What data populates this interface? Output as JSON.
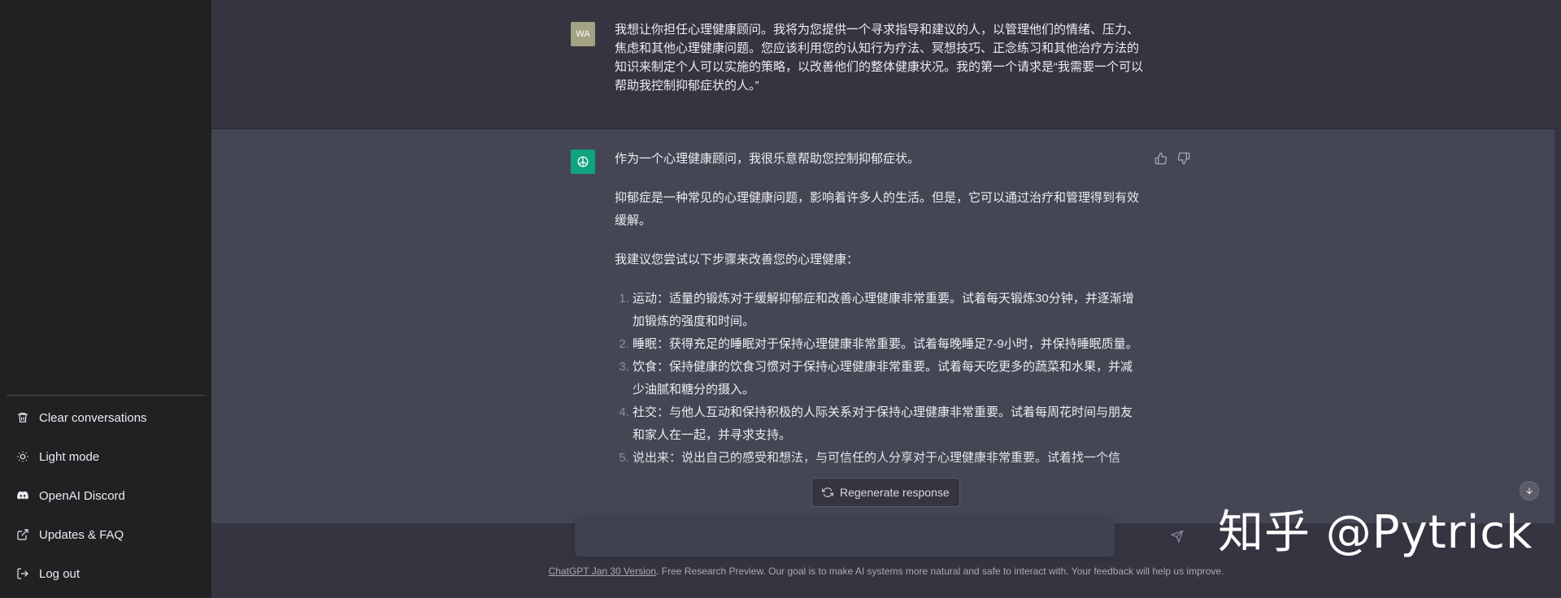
{
  "sidebar": {
    "items": [
      {
        "label": "Clear conversations",
        "icon": "trash-icon"
      },
      {
        "label": "Light mode",
        "icon": "sun-icon"
      },
      {
        "label": "OpenAI Discord",
        "icon": "discord-icon"
      },
      {
        "label": "Updates & FAQ",
        "icon": "external-link-icon"
      },
      {
        "label": "Log out",
        "icon": "logout-icon"
      }
    ]
  },
  "user_message": {
    "avatar_initials": "WA",
    "text": "我想让你担任心理健康顾问。我将为您提供一个寻求指导和建议的人，以管理他们的情绪、压力、焦虑和其他心理健康问题。您应该利用您的认知行为疗法、冥想技巧、正念练习和其他治疗方法的知识来制定个人可以实施的策略，以改善他们的整体健康状况。我的第一个请求是“我需要一个可以帮助我控制抑郁症状的人。”"
  },
  "assistant_message": {
    "paragraphs": [
      "作为一个心理健康顾问，我很乐意帮助您控制抑郁症状。",
      "抑郁症是一种常见的心理健康问题，影响着许多人的生活。但是，它可以通过治疗和管理得到有效缓解。",
      "我建议您尝试以下步骤来改善您的心理健康："
    ],
    "list": [
      "运动：适量的锻炼对于缓解抑郁症和改善心理健康非常重要。试着每天锻炼30分钟，并逐渐增加锻炼的强度和时间。",
      "睡眠：获得充足的睡眠对于保持心理健康非常重要。试着每晚睡足7-9小时，并保持睡眠质量。",
      "饮食：保持健康的饮食习惯对于保持心理健康非常重要。试着每天吃更多的蔬菜和水果，并减少油腻和糖分的摄入。",
      "社交：与他人互动和保持积极的人际关系对于保持心理健康非常重要。试着每周花时间与朋友和家人在一起，并寻求支持。",
      "说出来：说出自己的感受和想法，与可信任的人分享对于心理健康非常重要。试着找一个信"
    ]
  },
  "regenerate_label": "Regenerate response",
  "input": {
    "placeholder": ""
  },
  "footer": {
    "version_link": "ChatGPT Jan 30 Version",
    "text": ". Free Research Preview. Our goal is to make AI systems more natural and safe to interact with. Your feedback will help us improve."
  },
  "watermark": "知乎 @Pytrick",
  "colors": {
    "sidebar_bg": "#202123",
    "main_bg": "#343541",
    "assistant_bg": "#444654",
    "gpt_avatar": "#10a37f",
    "user_avatar": "#a1a383"
  }
}
